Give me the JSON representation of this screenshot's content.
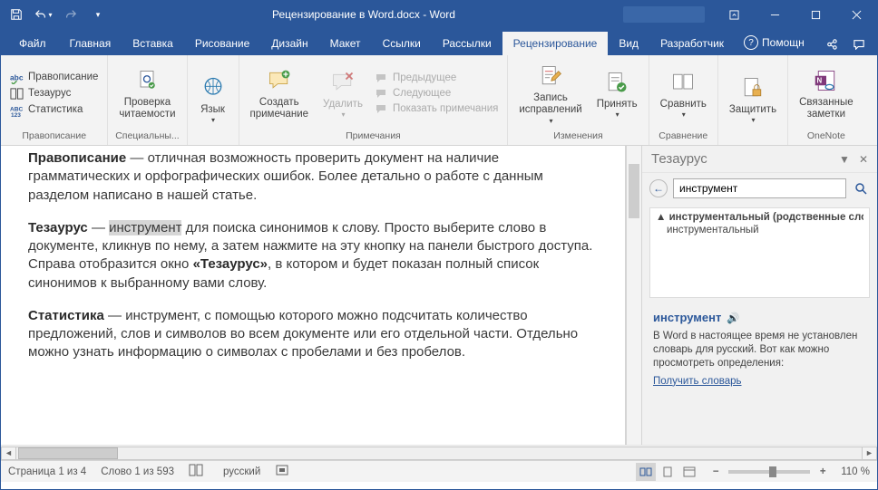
{
  "title": "Рецензирование в Word.docx  -  Word",
  "tabs": [
    "Файл",
    "Главная",
    "Вставка",
    "Рисование",
    "Дизайн",
    "Макет",
    "Ссылки",
    "Рассылки",
    "Рецензирование",
    "Вид",
    "Разработчик"
  ],
  "help_placeholder": "Помощн",
  "ribbon": {
    "proofing": {
      "spelling": "Правописание",
      "thesaurus": "Тезаурус",
      "stats": "Статистика",
      "label": "Правописание"
    },
    "accessibility": {
      "btn": "Проверка\nчитаемости",
      "label": "Специальны..."
    },
    "language": {
      "btn": "Язык",
      "label": ""
    },
    "comments": {
      "new": "Создать\nпримечание",
      "delete": "Удалить",
      "prev": "Предыдущее",
      "next": "Следующее",
      "show": "Показать примечания",
      "label": "Примечания"
    },
    "tracking": {
      "track": "Запись\nисправлений",
      "accept": "Принять",
      "label": "Изменения"
    },
    "compare": {
      "btn": "Сравнить",
      "label": "Сравнение"
    },
    "protect": {
      "btn": "Защитить",
      "label": ""
    },
    "onenote": {
      "btn": "Связанные\nзаметки",
      "label": "OneNote"
    }
  },
  "doc": {
    "p1a": "Правописание",
    "p1b": " — отличная возможность проверить документ на наличие грамматических и орфографических ошибок. Более детально о работе с данным разделом написано в нашей статье.",
    "p2a": "Тезаурус",
    "p2b": " — ",
    "p2word": "инструмент",
    "p2c": " для поиска синонимов к слову. Просто выберите слово в документе, кликнув по нему, а затем нажмите на эту кнопку на панели быстрого доступа. Справа отобразится окно ",
    "p2d": "«Тезаурус»",
    "p2e": ", в котором и будет показан полный список синонимов к выбранному вами слову.",
    "p3a": "Статистика",
    "p3b": " — инструмент, с помощью которого можно подсчитать количество предложений, слов и символов во всем документе или его отдельной части. Отдельно можно узнать информацию о символах с пробелами и без пробелов."
  },
  "pane": {
    "title": "Тезаурус",
    "search_value": "инструмент",
    "list_header": "инструментальный (родственные слова)",
    "list_item": "инструментальный",
    "word": "инструмент",
    "msg": "В Word в настоящее время не установлен словарь для русский. Вот как можно просмотреть определения:",
    "link": "Получить словарь"
  },
  "status": {
    "page": "Страница 1 из 4",
    "words": "Слово 1 из 593",
    "lang": "русский",
    "zoom": "110 %"
  }
}
